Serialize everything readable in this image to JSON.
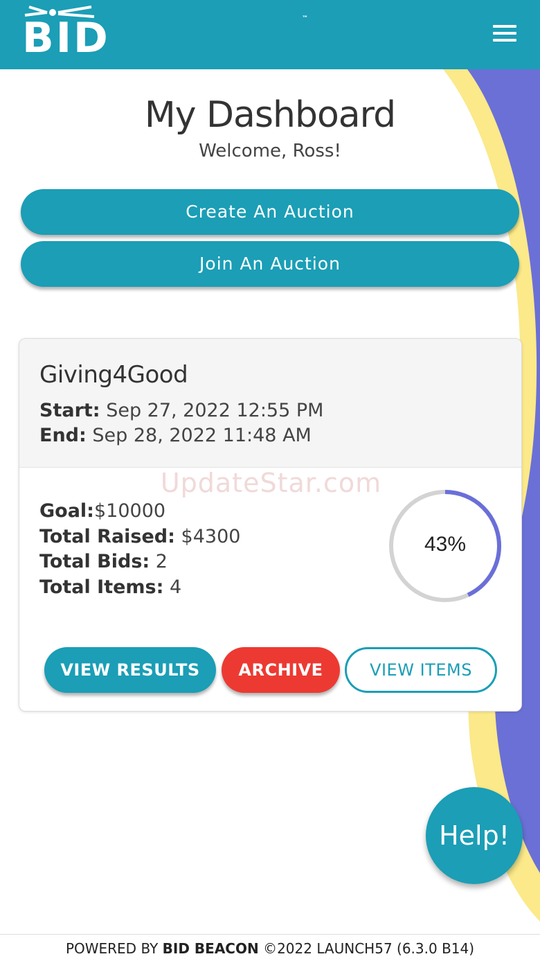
{
  "header": {
    "logo_text": "BID BEACON",
    "logo_tm": "™",
    "menu_icon": "hamburger-menu-icon"
  },
  "page": {
    "title": "My Dashboard",
    "welcome": "Welcome, Ross!"
  },
  "actions": {
    "create_label": "Create An Auction",
    "join_label": "Join An Auction"
  },
  "auction": {
    "name": "Giving4Good",
    "start_label": "Start:",
    "start_value": "Sep 27, 2022 12:55 PM",
    "end_label": "End:",
    "end_value": "Sep 28, 2022 11:48 AM",
    "goal_label": "Goal:",
    "goal_value": "$10000",
    "raised_label": "Total Raised:",
    "raised_value": "$4300",
    "bids_label": "Total Bids:",
    "bids_value": "2",
    "items_label": "Total Items:",
    "items_value": "4",
    "progress_fraction": 0.43,
    "progress_text": "43%",
    "buttons": {
      "view_results": "VIEW RESULTS",
      "archive": "ARCHIVE",
      "view_items": "VIEW ITEMS"
    }
  },
  "watermark": "UpdateStar.com",
  "help_label": "Help!",
  "footer": {
    "prefix": "POWERED BY",
    "brand": "BID BEACON",
    "suffix": "©2022 LAUNCH57 (6.3.0 B14)"
  },
  "colors": {
    "primary": "#1b9eb6",
    "archive": "#ec3a32",
    "progress": "#6a6fd8",
    "progress_track": "#d3d3d3",
    "wave_yellow": "#fbe98a",
    "wave_purple": "#6b70d6"
  }
}
